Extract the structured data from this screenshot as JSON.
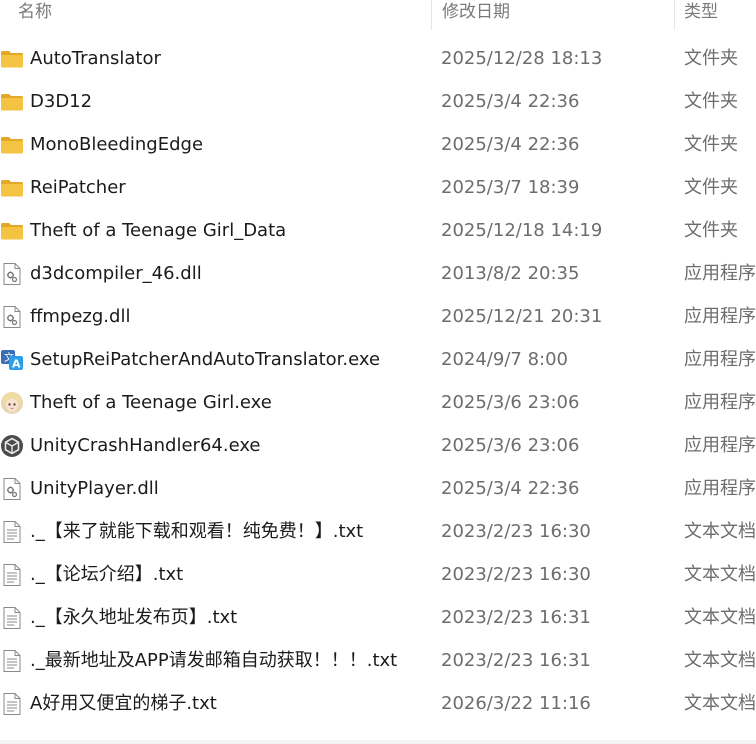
{
  "columns": {
    "name": "名称",
    "date": "修改日期",
    "type": "类型"
  },
  "rows": [
    {
      "name": "AutoTranslator",
      "date": "2025/12/28 18:13",
      "type": "文件夹",
      "icon": "folder-icon"
    },
    {
      "name": "D3D12",
      "date": "2025/3/4 22:36",
      "type": "文件夹",
      "icon": "folder-icon"
    },
    {
      "name": "MonoBleedingEdge",
      "date": "2025/3/4 22:36",
      "type": "文件夹",
      "icon": "folder-icon"
    },
    {
      "name": "ReiPatcher",
      "date": "2025/3/7 18:39",
      "type": "文件夹",
      "icon": "folder-icon"
    },
    {
      "name": "Theft of a Teenage Girl_Data",
      "date": "2025/12/18 14:19",
      "type": "文件夹",
      "icon": "folder-icon"
    },
    {
      "name": "d3dcompiler_46.dll",
      "date": "2013/8/2 20:35",
      "type": "应用程序",
      "icon": "dll-icon"
    },
    {
      "name": "ffmpezg.dll",
      "date": "2025/12/21 20:31",
      "type": "应用程序",
      "icon": "dll-icon"
    },
    {
      "name": "SetupReiPatcherAndAutoTranslator.exe",
      "date": "2024/9/7 8:00",
      "type": "应用程序",
      "icon": "translator-exe-icon"
    },
    {
      "name": "Theft of a Teenage Girl.exe",
      "date": "2025/3/6 23:06",
      "type": "应用程序",
      "icon": "game-exe-icon"
    },
    {
      "name": "UnityCrashHandler64.exe",
      "date": "2025/3/6 23:06",
      "type": "应用程序",
      "icon": "unity-icon"
    },
    {
      "name": "UnityPlayer.dll",
      "date": "2025/3/4 22:36",
      "type": "应用程序",
      "icon": "dll-icon"
    },
    {
      "name": "._【来了就能下载和观看！纯免费！】.txt",
      "date": "2023/2/23 16:30",
      "type": "文本文档",
      "icon": "text-file-icon"
    },
    {
      "name": "._【论坛介绍】.txt",
      "date": "2023/2/23 16:30",
      "type": "文本文档",
      "icon": "text-file-icon"
    },
    {
      "name": "._【永久地址发布页】.txt",
      "date": "2023/2/23 16:31",
      "type": "文本文档",
      "icon": "text-file-icon"
    },
    {
      "name": "._最新地址及APP请发邮箱自动获取！！！.txt",
      "date": "2023/2/23 16:31",
      "type": "文本文档",
      "icon": "text-file-icon"
    },
    {
      "name": "A好用又便宜的梯子.txt",
      "date": "2026/3/22 11:16",
      "type": "文本文档",
      "icon": "text-file-icon"
    }
  ],
  "colors": {
    "folder": "#F5C342",
    "folderDark": "#E3A827",
    "header_text": "#7A7A7A",
    "date_text": "#6D6D6D"
  }
}
